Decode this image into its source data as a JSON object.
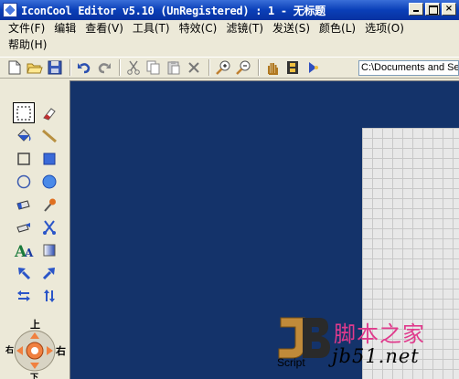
{
  "window": {
    "title": "IconCool Editor v5.10 (UnRegistered) : 1 - 无标题",
    "minimize": "minimize",
    "maximize": "maximize",
    "close": "×"
  },
  "menu": {
    "row1": [
      "文件(F)",
      "编辑",
      "查看(V)",
      "工具(T)",
      "特效(C)",
      "滤镜(T)",
      "发送(S)",
      "颜色(L)",
      "选项(O)"
    ],
    "row2": [
      "帮助(H)"
    ]
  },
  "toolbar": {
    "buttons": [
      "new-icon",
      "open-icon",
      "save-icon",
      "undo-icon",
      "redo-icon",
      "cut-icon",
      "copy-icon",
      "paste-icon",
      "delete-icon",
      "zoom-in-icon",
      "zoom-out-icon",
      "hand-icon",
      "film-icon",
      "wand-icon"
    ],
    "path_value": "C:\\Documents and Se"
  },
  "tools": [
    "select-rect-icon",
    "eraser-icon",
    "fill-bucket-icon",
    "line-icon",
    "rectangle-outline-icon",
    "rectangle-filled-icon",
    "ellipse-outline-icon",
    "ellipse-filled-icon",
    "airbrush-icon",
    "color-picker-icon",
    "smudge-icon",
    "scissors-icon",
    "text-icon",
    "gradient-icon",
    "rotate-left-icon",
    "rotate-right-icon",
    "flip-horizontal-icon",
    "flip-vertical-icon"
  ],
  "nav": {
    "up": "上",
    "left": "右",
    "right": "右",
    "down": "下"
  },
  "watermark": {
    "brand_cn": "脚本之家",
    "url": "jb51.net",
    "script_label": "Script"
  },
  "colors": {
    "workspace_bg": "#14336a",
    "title_bar": "#0a3fb8",
    "watermark_pink": "#e03a8c"
  }
}
